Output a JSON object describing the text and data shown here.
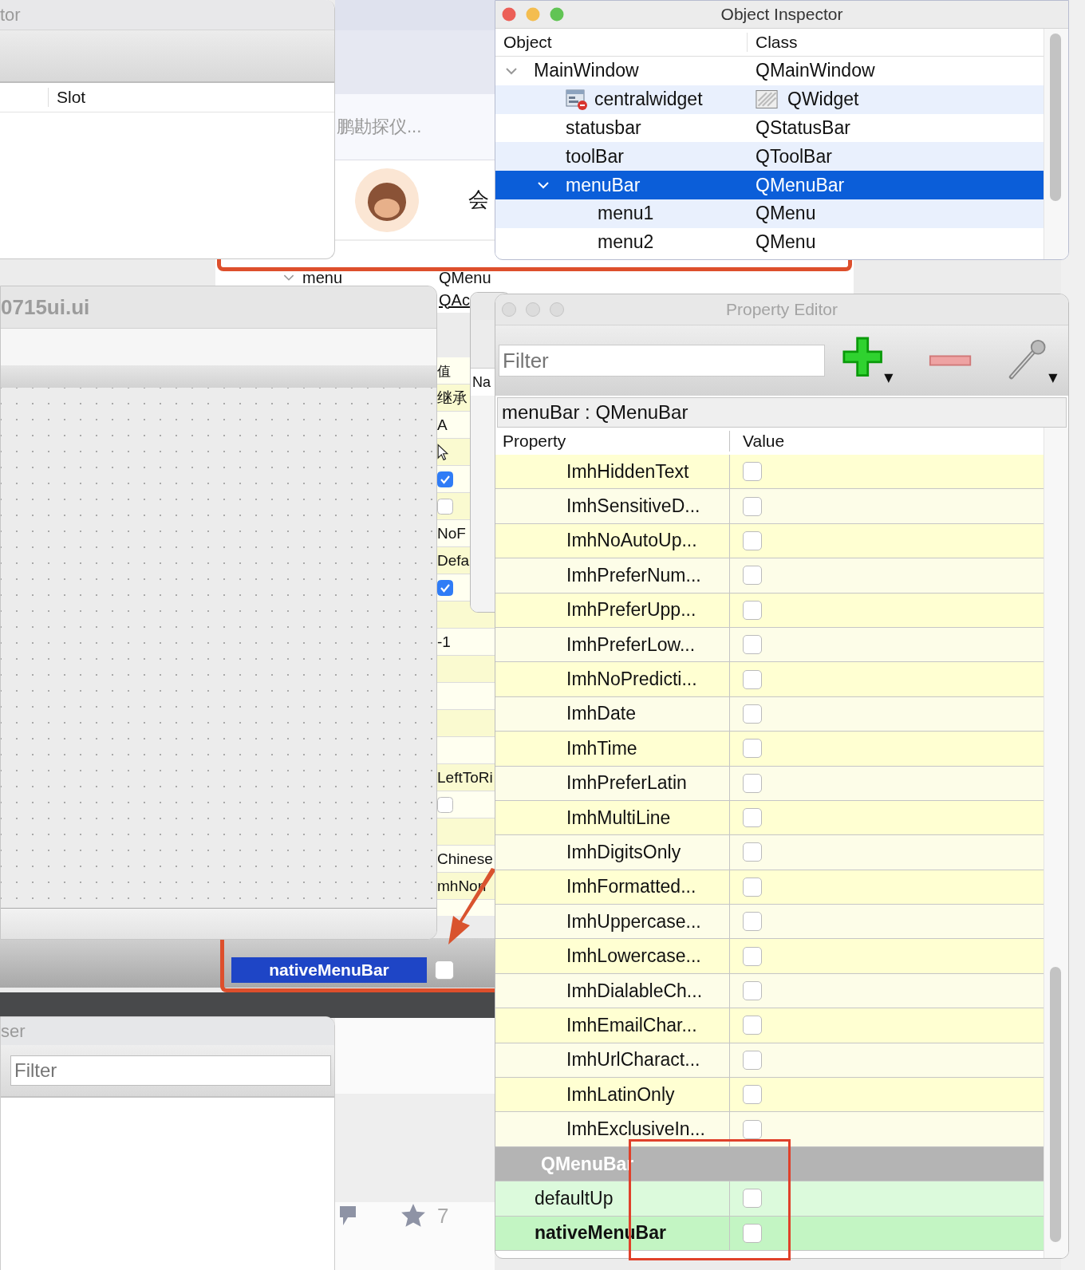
{
  "signal_slot_editor": {
    "title": "tor",
    "columns": [
      "Slot"
    ]
  },
  "browser_page_top": {
    "snippet": "鹏勘探仪...",
    "name_fragment": "会"
  },
  "background_object_tree": {
    "rows": [
      {
        "object": "menu",
        "class": "QMenu",
        "expanded": true
      },
      {
        "class": "QAc"
      }
    ]
  },
  "form_window": {
    "title": "0715ui.ui"
  },
  "background_property_column": {
    "header": "值",
    "cells": [
      {
        "kind": "text",
        "value": "继承"
      },
      {
        "kind": "text",
        "value": "A"
      },
      {
        "kind": "cursor"
      },
      {
        "kind": "check",
        "checked": true
      },
      {
        "kind": "check",
        "checked": false
      },
      {
        "kind": "text",
        "value": "NoF"
      },
      {
        "kind": "text",
        "value": "Defa"
      },
      {
        "kind": "check",
        "checked": true
      },
      {
        "kind": "empty"
      },
      {
        "kind": "text",
        "value": "-1"
      },
      {
        "kind": "empty"
      },
      {
        "kind": "empty"
      },
      {
        "kind": "empty"
      },
      {
        "kind": "empty"
      },
      {
        "kind": "text",
        "value": "LeftToRi"
      },
      {
        "kind": "check",
        "checked": false
      },
      {
        "kind": "empty"
      },
      {
        "kind": "text",
        "value": "Chinese"
      },
      {
        "kind": "text",
        "value": "mhNon"
      }
    ]
  },
  "background_dialog": {
    "header": "Na"
  },
  "background_selected_property": {
    "name": "nativeMenuBar",
    "checked": false
  },
  "resource_browser": {
    "title": "ser",
    "filter": {
      "placeholder": "Filter"
    }
  },
  "browser_page_bottom": {
    "star_count": "7"
  },
  "object_inspector": {
    "title": "Object Inspector",
    "columns": [
      "Object",
      "Class"
    ],
    "rows": [
      {
        "object": "MainWindow",
        "class": "QMainWindow",
        "kind": "object",
        "expanded": true,
        "selected": false,
        "children": [
          {
            "object": "centralwidget",
            "class": "QWidget",
            "kind": "widget",
            "selected": false
          },
          {
            "object": "statusbar",
            "class": "QStatusBar",
            "kind": "object",
            "selected": false
          },
          {
            "object": "toolBar",
            "class": "QToolBar",
            "kind": "object",
            "selected": false
          },
          {
            "object": "menuBar",
            "class": "QMenuBar",
            "kind": "object",
            "expanded": true,
            "selected": true,
            "children": [
              {
                "object": "menu1",
                "class": "QMenu",
                "kind": "object",
                "selected": false
              },
              {
                "object": "menu2",
                "class": "QMenu",
                "kind": "object",
                "selected": false
              }
            ]
          }
        ]
      }
    ]
  },
  "property_editor": {
    "title": "Property Editor",
    "filter": {
      "placeholder": "Filter"
    },
    "object_label": "menuBar : QMenuBar",
    "columns": [
      "Property",
      "Value"
    ],
    "rows": [
      {
        "kind": "flag",
        "name": "ImhHiddenText",
        "checked": false
      },
      {
        "kind": "flag",
        "name": "ImhSensitiveD...",
        "checked": false
      },
      {
        "kind": "flag",
        "name": "ImhNoAutoUp...",
        "checked": false
      },
      {
        "kind": "flag",
        "name": "ImhPreferNum...",
        "checked": false
      },
      {
        "kind": "flag",
        "name": "ImhPreferUpp...",
        "checked": false
      },
      {
        "kind": "flag",
        "name": "ImhPreferLow...",
        "checked": false
      },
      {
        "kind": "flag",
        "name": "ImhNoPredicti...",
        "checked": false
      },
      {
        "kind": "flag",
        "name": "ImhDate",
        "checked": false
      },
      {
        "kind": "flag",
        "name": "ImhTime",
        "checked": false
      },
      {
        "kind": "flag",
        "name": "ImhPreferLatin",
        "checked": false
      },
      {
        "kind": "flag",
        "name": "ImhMultiLine",
        "checked": false
      },
      {
        "kind": "flag",
        "name": "ImhDigitsOnly",
        "checked": false
      },
      {
        "kind": "flag",
        "name": "ImhFormatted...",
        "checked": false
      },
      {
        "kind": "flag",
        "name": "ImhUppercase...",
        "checked": false
      },
      {
        "kind": "flag",
        "name": "ImhLowercase...",
        "checked": false
      },
      {
        "kind": "flag",
        "name": "ImhDialableCh...",
        "checked": false
      },
      {
        "kind": "flag",
        "name": "ImhEmailChar...",
        "checked": false
      },
      {
        "kind": "flag",
        "name": "ImhUrlCharact...",
        "checked": false
      },
      {
        "kind": "flag",
        "name": "ImhLatinOnly",
        "checked": false
      },
      {
        "kind": "flag",
        "name": "ImhExclusiveIn...",
        "checked": false
      },
      {
        "kind": "section",
        "name": "QMenuBar"
      },
      {
        "kind": "bool",
        "name": "defaultUp",
        "checked": false,
        "changed": false
      },
      {
        "kind": "bool",
        "name": "nativeMenuBar",
        "checked": false,
        "changed": true
      }
    ]
  }
}
